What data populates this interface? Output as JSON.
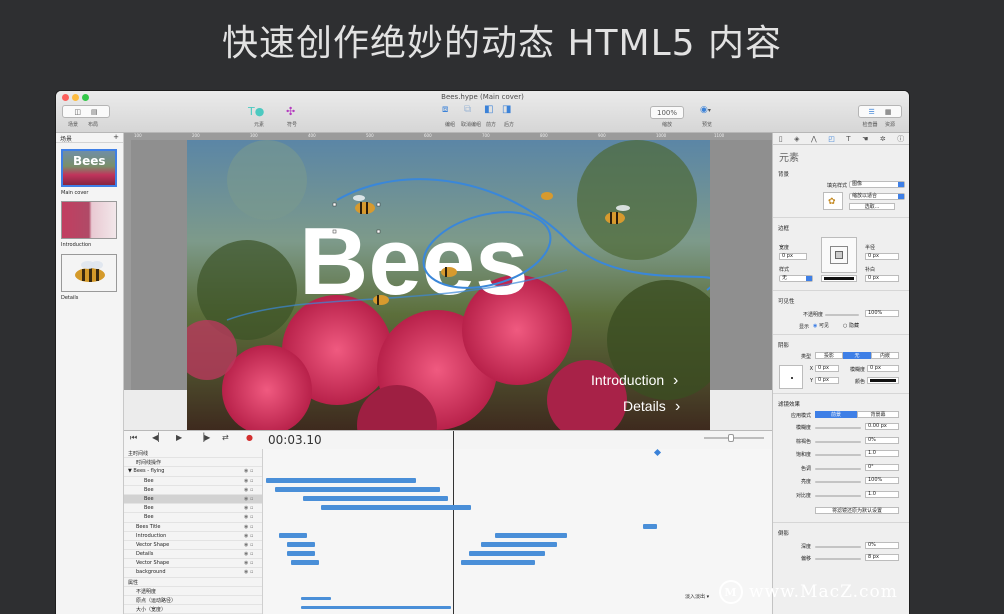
{
  "headline": "快速创作绝妙的动态 HTML5 内容",
  "window": {
    "title": "Bees.hype (Main cover)",
    "toolbar": {
      "scenes_label": "场景",
      "layout_label": "布局",
      "elements_label": "元素",
      "symbols_label": "符号",
      "group_label": "编组",
      "ungroup_label": "取消编组",
      "front_label": "前方",
      "back_label": "后方",
      "zoom_value": "100%",
      "zoom_label": "缩放",
      "preview_label": "预览",
      "inspector_label": "检查器",
      "resources_label": "资源"
    }
  },
  "scenes": {
    "header": "场景",
    "add": "+",
    "items": [
      {
        "label": "Main cover",
        "thumb_text": "Bees"
      },
      {
        "label": "Introduction"
      },
      {
        "label": "Details"
      }
    ]
  },
  "ruler_ticks": [
    "100",
    "200",
    "300",
    "400",
    "500",
    "600",
    "700",
    "800",
    "900",
    "1000",
    "1100"
  ],
  "stage": {
    "title": "Bees",
    "link_intro": "Introduction",
    "link_details": "Details",
    "colors": {
      "sky": "#5f86a3",
      "flowers": "#d8345d",
      "foliage": "#4c6a2c"
    }
  },
  "timeline": {
    "time": "00:03.10",
    "rows": [
      {
        "name": "主时间线",
        "indent": 0
      },
      {
        "name": "时间线操作",
        "indent": 1
      },
      {
        "name": "▼ Bees - flying",
        "indent": 0
      },
      {
        "name": "Bee",
        "indent": 2
      },
      {
        "name": "Bee",
        "indent": 2
      },
      {
        "name": "Bee",
        "indent": 2
      },
      {
        "name": "Bee",
        "indent": 2
      },
      {
        "name": "Bee",
        "indent": 2
      },
      {
        "name": "Bees Title",
        "indent": 1
      },
      {
        "name": "Introduction",
        "indent": 1
      },
      {
        "name": "Vector Shape",
        "indent": 1
      },
      {
        "name": "Details",
        "indent": 1
      },
      {
        "name": "Vector Shape",
        "indent": 1
      },
      {
        "name": "background",
        "indent": 1
      },
      {
        "name": "属性",
        "indent": 0
      },
      {
        "name": "不透明度",
        "indent": 1
      },
      {
        "name": "原点（运动路径）",
        "indent": 1
      },
      {
        "name": "大小（宽度）",
        "indent": 1
      }
    ],
    "easing_label": "淡入淡出"
  },
  "inspector": {
    "title": "元素",
    "background": {
      "section": "背景",
      "fill_style_label": "填充样式",
      "fill_style_value": "图像",
      "scale_value": "缩放以适合",
      "choose_button": "选取..."
    },
    "border": {
      "section": "边框",
      "width_label": "宽度",
      "width_value": "0 px",
      "radius_label": "半径",
      "radius_value": "0 px",
      "style_label": "样式",
      "style_value": "无",
      "padding_label": "补白",
      "padding_value": "0 px"
    },
    "visibility": {
      "section": "可见性",
      "opacity_label": "不透明度",
      "opacity_value": "100%",
      "display_label": "显示",
      "visible": "可见",
      "hidden": "隐藏"
    },
    "shadow": {
      "section": "阴影",
      "type_label": "类型",
      "types": [
        "投影",
        "无",
        "内嵌"
      ],
      "x_label": "X",
      "x_value": "0 px",
      "y_label": "Y",
      "y_value": "0 px",
      "blur_label": "模糊度",
      "blur_value": "0 px",
      "color_label": "颜色"
    },
    "filters": {
      "section": "滤镜效果",
      "apply_label": "应用模式",
      "modes": [
        "前景",
        "背景幕"
      ],
      "items": [
        {
          "label": "模糊度",
          "value": "0.00 px"
        },
        {
          "label": "棕褐色",
          "value": "0%"
        },
        {
          "label": "饱和度",
          "value": "1.0"
        },
        {
          "label": "色调",
          "value": "0°"
        },
        {
          "label": "亮度",
          "value": "100%"
        },
        {
          "label": "对比度",
          "value": "1.0"
        }
      ],
      "reset_button": "将滤镜还原为默认设置"
    },
    "reflection": {
      "section": "倒影",
      "depth_label": "深度",
      "depth_value": "0%",
      "offset_label": "偏移",
      "offset_value": "8 px"
    }
  },
  "watermark": {
    "logo": "M",
    "text": "www.MacZ.com"
  }
}
